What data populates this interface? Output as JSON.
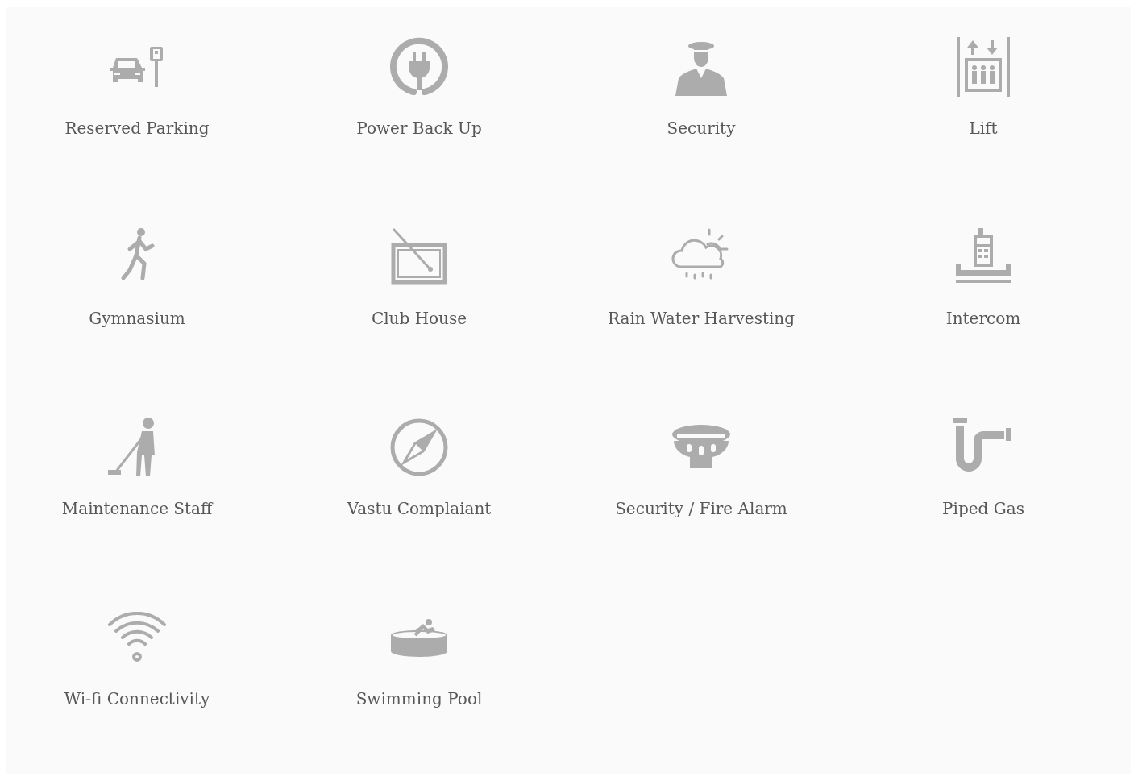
{
  "amenities": [
    {
      "label": "Reserved Parking"
    },
    {
      "label": "Power Back Up"
    },
    {
      "label": "Security"
    },
    {
      "label": "Lift"
    },
    {
      "label": "Gymnasium"
    },
    {
      "label": "Club House"
    },
    {
      "label": "Rain Water Harvesting"
    },
    {
      "label": "Intercom"
    },
    {
      "label": "Maintenance Staff"
    },
    {
      "label": "Vastu Complaiant"
    },
    {
      "label": "Security / Fire Alarm"
    },
    {
      "label": "Piped Gas"
    },
    {
      "label": "Wi-fi Connectivity"
    },
    {
      "label": "Swimming Pool"
    }
  ]
}
